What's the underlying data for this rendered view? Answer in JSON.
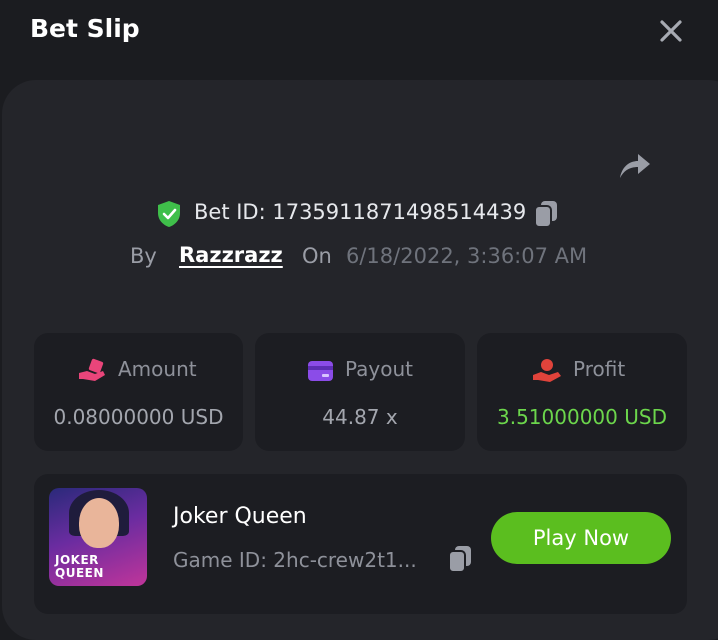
{
  "header": {
    "title": "Bet Slip",
    "close_icon": "close-icon"
  },
  "bet": {
    "id_label": "Bet ID: 1735911871498514439",
    "by_label": "By",
    "user": "Razzrazz",
    "on_label": "On",
    "datetime": "6/18/2022, 3:36:07 AM"
  },
  "stats": {
    "amount": {
      "label": "Amount",
      "value": "0.08000000 USD",
      "icon": "bet-hand-icon",
      "color": "#e9457a"
    },
    "payout": {
      "label": "Payout",
      "value": "44.87 x",
      "icon": "card-icon",
      "color": "#8b4ce8"
    },
    "profit": {
      "label": "Profit",
      "value": "3.51000000 USD",
      "icon": "profit-hand-icon",
      "color": "#e0433b",
      "value_color": "#6cd64c"
    }
  },
  "game": {
    "name": "Joker Queen",
    "id_label": "Game ID: 2hc-crew2t1...",
    "play_label": "Play Now",
    "thumb_text_1": "JOKER",
    "thumb_text_2": "QUEEN"
  },
  "colors": {
    "accent_green": "#5bbe1f",
    "background": "#1b1c20",
    "panel": "#24252a"
  }
}
